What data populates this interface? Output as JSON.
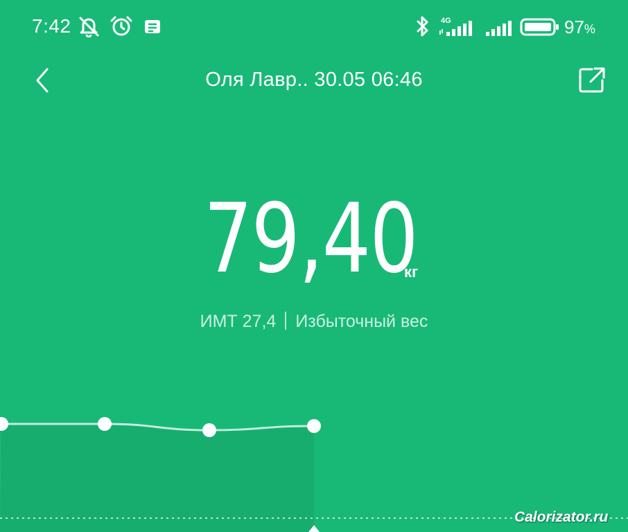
{
  "status_bar": {
    "time": "7:42",
    "battery_percent": "97",
    "battery_symbol": "%",
    "network_label": "4G",
    "icons": [
      "muted-bell-icon",
      "alarm-clock-icon",
      "notification-icon",
      "bluetooth-icon",
      "signal-4g-icon",
      "signal-icon",
      "battery-icon"
    ]
  },
  "header": {
    "title": "Оля Лавр.. 30.05 06:46",
    "back_icon": "chevron-left-icon",
    "share_icon": "share-icon"
  },
  "measurement": {
    "weight": "79,40",
    "unit": "кг",
    "bmi_label": "ИМТ 27,4",
    "bmi_status": "Избыточный вес"
  },
  "chart_data": {
    "type": "line",
    "title": "",
    "xlabel": "",
    "ylabel": "",
    "x": [
      1,
      2,
      3,
      4
    ],
    "values": [
      79.42,
      79.42,
      79.36,
      79.4
    ],
    "ylim": [
      79.0,
      80.0
    ],
    "selected_index": 3,
    "grid": false,
    "legend": "none"
  },
  "colors": {
    "background": "#18b977",
    "area_fill": "#17ad6f",
    "line": "#ffffff"
  },
  "watermark": "Calorizator.ru"
}
